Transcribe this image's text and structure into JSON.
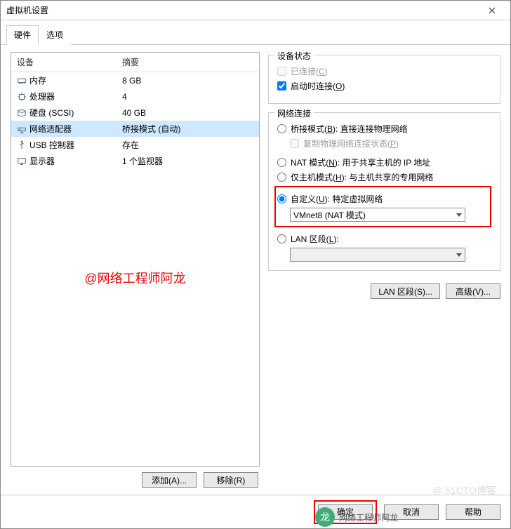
{
  "window": {
    "title": "虚拟机设置"
  },
  "tabs": {
    "hardware": "硬件",
    "options": "选项",
    "active": "hardware"
  },
  "table": {
    "headers": {
      "device": "设备",
      "summary": "摘要"
    },
    "rows": [
      {
        "device": "内存",
        "summary": "8 GB",
        "icon": "memory"
      },
      {
        "device": "处理器",
        "summary": "4",
        "icon": "cpu"
      },
      {
        "device": "硬盘 (SCSI)",
        "summary": "40 GB",
        "icon": "disk"
      },
      {
        "device": "网络适配器",
        "summary": "桥接模式 (自动)",
        "icon": "net",
        "selected": true
      },
      {
        "device": "USB 控制器",
        "summary": "存在",
        "icon": "usb"
      },
      {
        "device": "显示器",
        "summary": "1 个监视器",
        "icon": "display"
      }
    ]
  },
  "watermark": "@网络工程师阿龙",
  "leftButtons": {
    "add": "添加(A)...",
    "remove": "移除(R)"
  },
  "deviceStatus": {
    "title": "设备状态",
    "connected": {
      "label": "已连接(C)",
      "checked": false,
      "disabled": true
    },
    "connectAtPowerOn": {
      "label": "启动时连接(O)",
      "checked": true
    }
  },
  "netConn": {
    "title": "网络连接",
    "bridged": {
      "label": "桥接模式(B): 直接连接物理网络",
      "letter": "B"
    },
    "replicate": {
      "label": "复制物理网络连接状态(P)",
      "disabled": true
    },
    "nat": {
      "label": "NAT 模式(N): 用于共享主机的 IP 地址",
      "letter": "N"
    },
    "hostonly": {
      "label": "仅主机模式(H): 与主机共享的专用网络",
      "letter": "H"
    },
    "custom": {
      "label": "自定义(U): 特定虚拟网络",
      "letter": "U",
      "selected": true
    },
    "customCombo": "VMnet8 (NAT 模式)",
    "lanSeg": {
      "label": "LAN 区段(L):",
      "letter": "L"
    },
    "lanCombo": ""
  },
  "rightButtons": {
    "lanSeg": "LAN 区段(S)...",
    "advanced": "高级(V)..."
  },
  "footer": {
    "ok": "确定",
    "cancel": "取消",
    "help": "帮助"
  },
  "floating": {
    "name": "网络工程师阿龙"
  },
  "faint": "@ 51CTO博客"
}
